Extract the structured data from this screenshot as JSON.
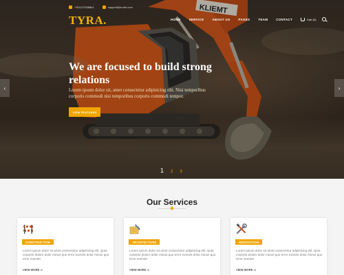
{
  "topbar": {
    "phone": "+3011278368b1",
    "email": "support@euofe.com"
  },
  "brand": {
    "logo": "TYRA."
  },
  "nav": {
    "items": [
      "HOME",
      "SERVICE",
      "ABOUT US",
      "PAGES",
      "TEAM",
      "CONTACT"
    ],
    "cart_label": "Cart (0)"
  },
  "hero": {
    "headline_line1": "We are focused to build strong",
    "headline_line2": "relations",
    "subtext": "Lorem ipsum dolor sit, amet consectetur adipisicing elit. Nisi temporibus corporis commodi nisi temporibus corporis commodi tempor.",
    "button_label": "VIEW FEATURES",
    "slides": [
      "1",
      "2",
      "3"
    ],
    "active_slide": "1",
    "prev_arrow": "‹",
    "next_arrow": "›"
  },
  "services": {
    "title": "Our Services",
    "cards": [
      {
        "icon": "barrier-icon",
        "tag": "CONSTRUCTION",
        "text": "Lorem ipsum dolor sit amet consectetur adipisicing elit. Quia corporis dolore dolor minus quo error eveniet dolor minus quo error eveniet",
        "more": "VIEW MORE ⇒"
      },
      {
        "icon": "architecture-icon",
        "tag": "ARCHITECTURE",
        "text": "Lorem ipsum dolor sit amet consectetur adipisicing elit. Quia corporis dolore dolor minus quo error eveniet dolor minus quo error eveniet",
        "more": "VIEW MORE ⇒"
      },
      {
        "icon": "tools-icon",
        "tag": "RENOVATION",
        "text": "Lorem ipsum dolor sit amet consectetur adipisicing elit. Quia corporis dolore dolor minus quo error eveniet dolor minus quo error eveniet",
        "more": "VIEW MORE ⇒"
      }
    ]
  },
  "colors": {
    "accent": "#f0a500",
    "hero_dark": "#3b3128",
    "excavator_orange": "#d4581c"
  }
}
